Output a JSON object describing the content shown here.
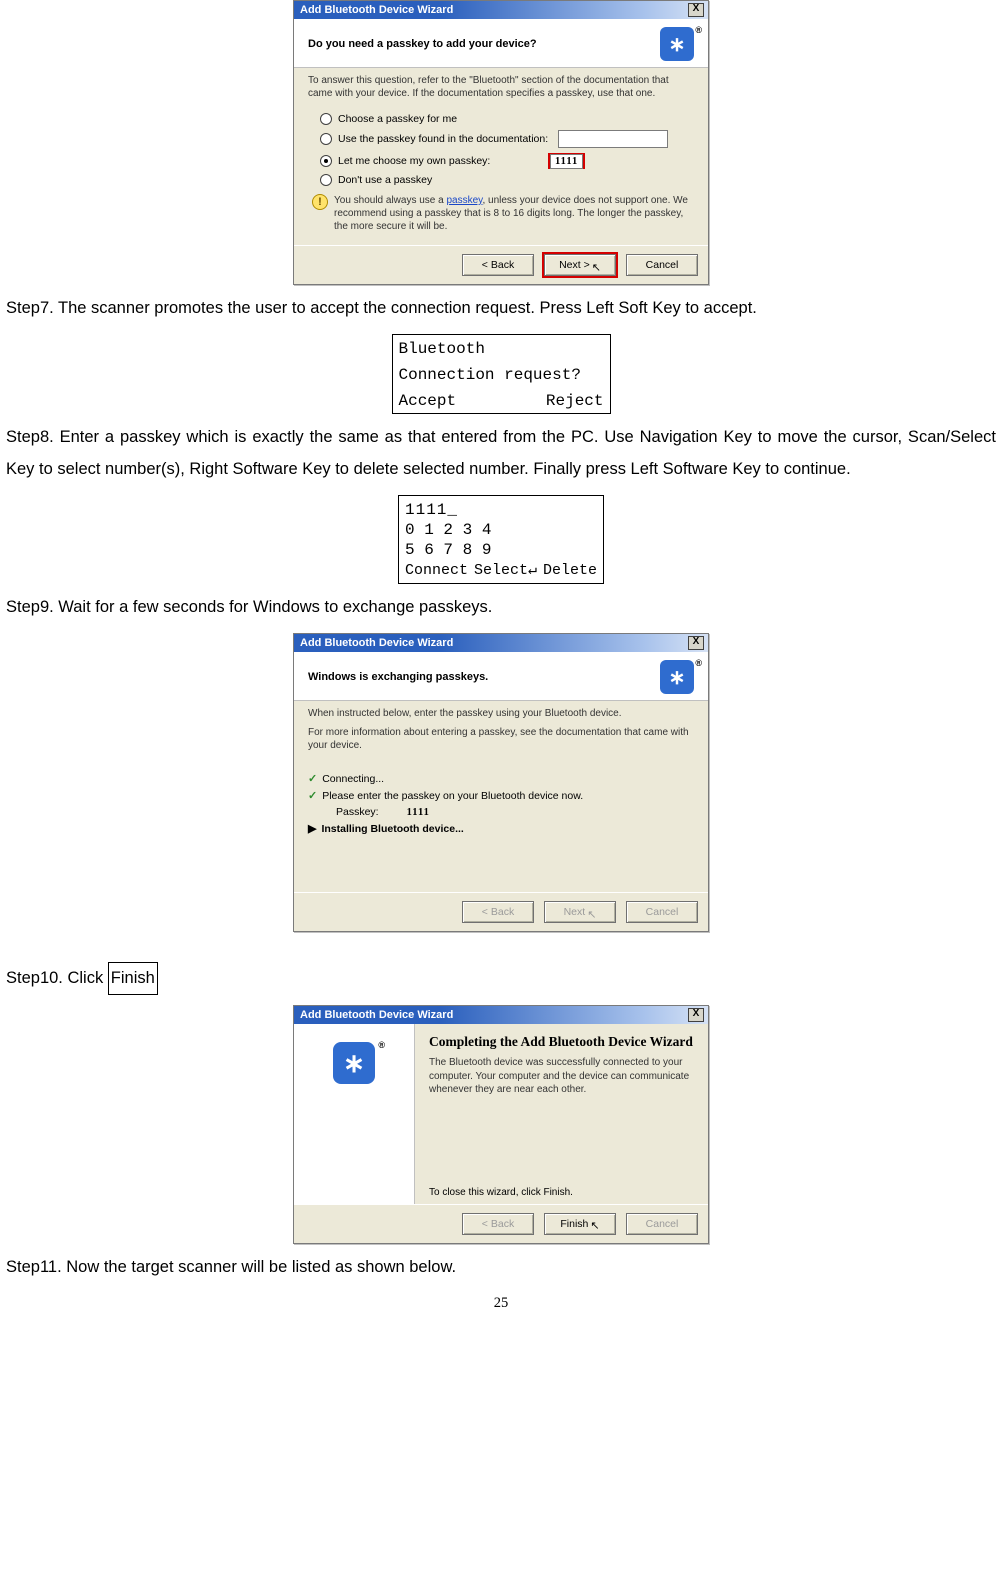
{
  "dialog1": {
    "title": "Add Bluetooth Device Wizard",
    "close_x": "X",
    "heading": "Do you need a passkey to add your device?",
    "bt_glyph": "∗",
    "hint": "To answer this question, refer to the \"Bluetooth\" section of the documentation that came with your device. If the documentation specifies a passkey, use that one.",
    "radio_choose": "Choose a passkey for me",
    "radio_doc": "Use the passkey found in the documentation:",
    "radio_own": "Let me choose my own passkey:",
    "own_value": "1111",
    "radio_none": "Don't use a passkey",
    "info_text_pre": "You should always use a ",
    "info_link": "passkey",
    "info_text_post": ", unless your device does not support one. We recommend using a passkey that is 8 to 16 digits long. The longer the passkey, the more secure it will be.",
    "btn_back": "< Back",
    "btn_next": "Next >",
    "btn_cancel": "Cancel"
  },
  "step7_text": "Step7. The scanner promotes the user to accept the connection request. Press Left Soft Key to accept.",
  "lcd1": {
    "line1": "Bluetooth",
    "line2": "Connection request?",
    "left": "Accept",
    "right": "Reject"
  },
  "step8_text": "Step8. Enter a passkey which is exactly the same as that entered from the PC. Use Navigation Key to move the cursor, Scan/Select Key to select number(s), Right Software Key to delete selected number. Finally press Left Software Key to continue.",
  "lcd2": {
    "entry": "1111_",
    "row1": "0 1 2 3 4",
    "row2": "5 6 7 8 9",
    "left": "Connect",
    "mid": "Select↵",
    "right": "Delete"
  },
  "step9_text": "Step9. Wait for a few seconds for Windows to exchange passkeys.",
  "dialog2": {
    "title": "Add Bluetooth Device Wizard",
    "close_x": "X",
    "heading": "Windows is exchanging passkeys.",
    "instr": "When instructed below, enter the passkey using your Bluetooth device.",
    "moreinfo": "For more information about entering a passkey, see the documentation that came with your device.",
    "line_connecting": "Connecting...",
    "line_enter": "Please enter the passkey on your Bluetooth device now.",
    "pass_label": "Passkey:",
    "pass_value": "1111",
    "line_install": "Installing Bluetooth device...",
    "btn_back": "< Back",
    "btn_next": "Next",
    "btn_cancel": "Cancel"
  },
  "step10_pre": "Step10. Click ",
  "step10_box": "Finish",
  "dialog3": {
    "title": "Add Bluetooth Device Wizard",
    "close_x": "X",
    "heading": "Completing the Add Bluetooth Device Wizard",
    "body": "The Bluetooth device was successfully connected to your computer. Your computer and the device can communicate whenever they are near each other.",
    "close_text": "To close this wizard, click Finish.",
    "btn_back": "< Back",
    "btn_finish": "Finish",
    "btn_cancel": "Cancel"
  },
  "step11_text": "Step11. Now the target scanner will be listed as shown below.",
  "page_number": "25"
}
